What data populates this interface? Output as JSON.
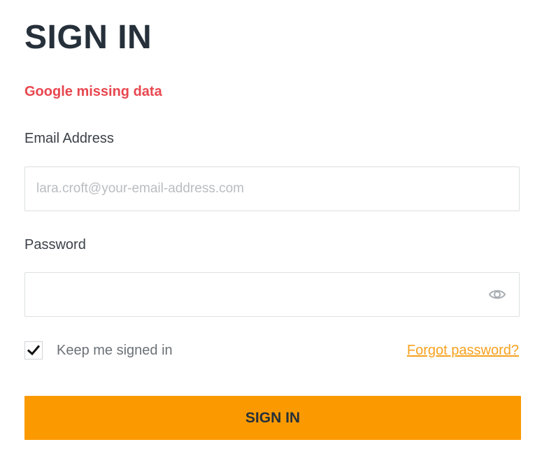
{
  "title": "SIGN IN",
  "error_message": "Google missing data",
  "email": {
    "label": "Email Address",
    "placeholder": "lara.croft@your-email-address.com",
    "value": ""
  },
  "password": {
    "label": "Password",
    "value": "",
    "toggle_icon": "eye-icon"
  },
  "remember": {
    "label": "Keep me signed in",
    "checked": true
  },
  "forgot_password": "Forgot password?",
  "submit_label": "SIGN IN",
  "colors": {
    "accent": "#fb9a00",
    "error": "#e8474f",
    "link": "#f7a11f",
    "heading": "#26303a"
  }
}
